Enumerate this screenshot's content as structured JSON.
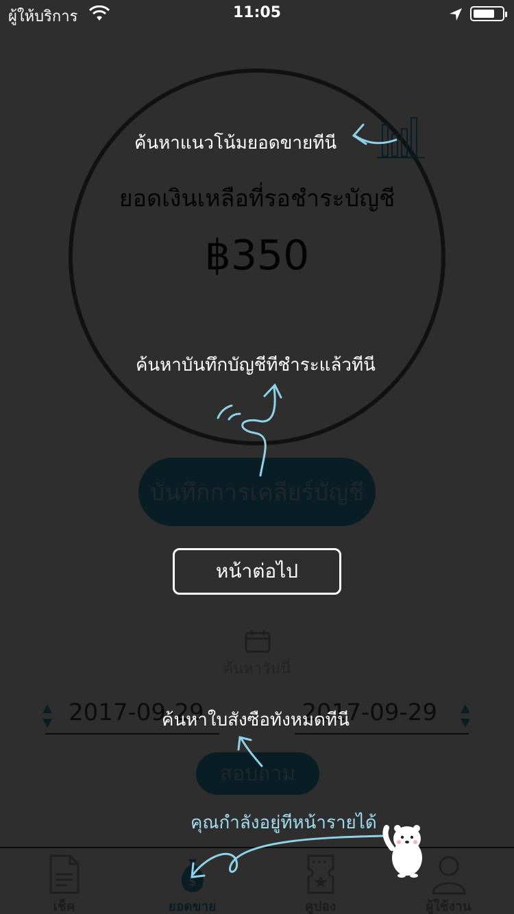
{
  "status_bar": {
    "carrier": "ผู้ให้บริการ",
    "time": "11:05"
  },
  "balance": {
    "title": "ยอดเงินเหลือที่รอชำระบัญชี",
    "amount": "฿350"
  },
  "clear_button_label": "บันทึกการเคลียร์บัญชี",
  "date_search": {
    "label": "ค้นหาวันนี่",
    "start_date": "2017-09-29",
    "end_date": "2017-09-29"
  },
  "query_button_label": "สอบถาม",
  "tabs": [
    {
      "label": "เช็ค",
      "icon": "document-icon",
      "active": false
    },
    {
      "label": "ยอดขาย",
      "icon": "money-bag-icon",
      "active": true
    },
    {
      "label": "คูปอง",
      "icon": "ticket-icon",
      "active": false
    },
    {
      "label": "ผู้ใช้งาน",
      "icon": "user-icon",
      "active": false
    }
  ],
  "tutorial": {
    "trend_hint": "ค้นหาแนวโน้มยอดขายทีนี",
    "history_hint": "ค้นหาบันทึกบัญชีทีชำระแล้วทีนี",
    "orders_hint": "ค้นหาใบสังซือทังหมดทีนี",
    "current_page_hint": "คุณกำลังอยู่ทีหน้ารายได้",
    "next_button": "หน้าต่อไป"
  },
  "colors": {
    "accent": "#2ea0c6",
    "hint_cyan": "#9fdcef"
  }
}
